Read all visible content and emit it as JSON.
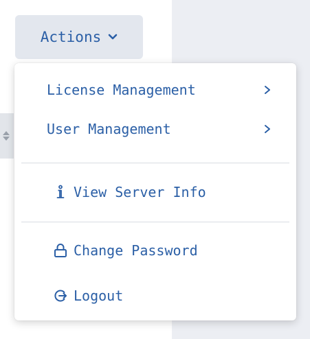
{
  "actions_button": {
    "label": "Actions",
    "icon": "chevron-down-icon"
  },
  "menu": {
    "items": [
      {
        "label": "License Management",
        "trailing_icon": "chevron-right-icon"
      },
      {
        "label": "User Management",
        "trailing_icon": "chevron-right-icon"
      },
      {
        "label": "View Server Info",
        "leading_icon": "info-icon"
      },
      {
        "label": "Change Password",
        "leading_icon": "lock-icon"
      },
      {
        "label": "Logout",
        "leading_icon": "logout-icon"
      }
    ]
  },
  "colors": {
    "accent": "#2b5fa6",
    "button_bg": "#e3e7ee",
    "menu_bg": "#ffffff",
    "divider": "#d8dce2",
    "page_bg": "#eceef3"
  }
}
